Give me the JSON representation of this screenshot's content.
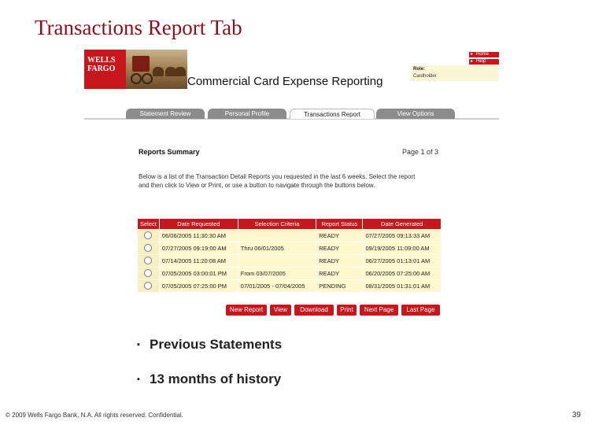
{
  "slide": {
    "title": "Transactions Report Tab",
    "footer": "© 2009 Wells Fargo Bank, N.A. All rights reserved. Confidential.",
    "page_number": "39",
    "bullets": [
      "Previous Statements",
      "13 months of history"
    ],
    "bullet_mark": "▪"
  },
  "app": {
    "logo_line1": "WELLS",
    "logo_line2": "FARGO",
    "banner": "Commercial Card Expense Reporting",
    "top_links": [
      "Home",
      "Help"
    ],
    "role_label": "Role:",
    "role_value": "Cardholder",
    "tabs": [
      "Statement Review",
      "Personal Profile",
      "Transactions Report",
      "View Options"
    ],
    "active_tab": 2
  },
  "report": {
    "title": "Reports Summary",
    "page_info": "Page 1 of 3",
    "description": "Below is a list of the Transaction Detail Reports you requested in the last 6 weeks. Select the report and then click to View or Print, or use a button to navigate through the buttons below.",
    "columns": [
      "Select",
      "Date Requested",
      "Selection Criteria",
      "Report Status",
      "Date Generated"
    ],
    "rows": [
      {
        "date_requested": "06/06/2005 11:30:30 AM",
        "criteria": "",
        "status": "READY",
        "date_generated": "07/27/2005 09:13:33 AM"
      },
      {
        "date_requested": "07/27/2005 09:19:00 AM",
        "criteria": "Thru 06/01/2005",
        "status": "READY",
        "date_generated": "09/19/2005 11:09:00 AM"
      },
      {
        "date_requested": "07/14/2005 11:20:08 AM",
        "criteria": "",
        "status": "READY",
        "date_generated": "06/27/2005 01:13:01 AM"
      },
      {
        "date_requested": "07/05/2005 03:00:01 PM",
        "criteria": "From 03/07/2005",
        "status": "READY",
        "date_generated": "06/20/2005 07:25:00 AM"
      },
      {
        "date_requested": "07/05/2005 07:25:00 PM",
        "criteria": "07/01/2005 - 07/04/2005",
        "status": "PENDING",
        "date_generated": "08/31/2005 01:31:01 AM"
      }
    ],
    "buttons": [
      "New Report",
      "View",
      "Download",
      "Print",
      "Next Page",
      "Last Page"
    ]
  }
}
